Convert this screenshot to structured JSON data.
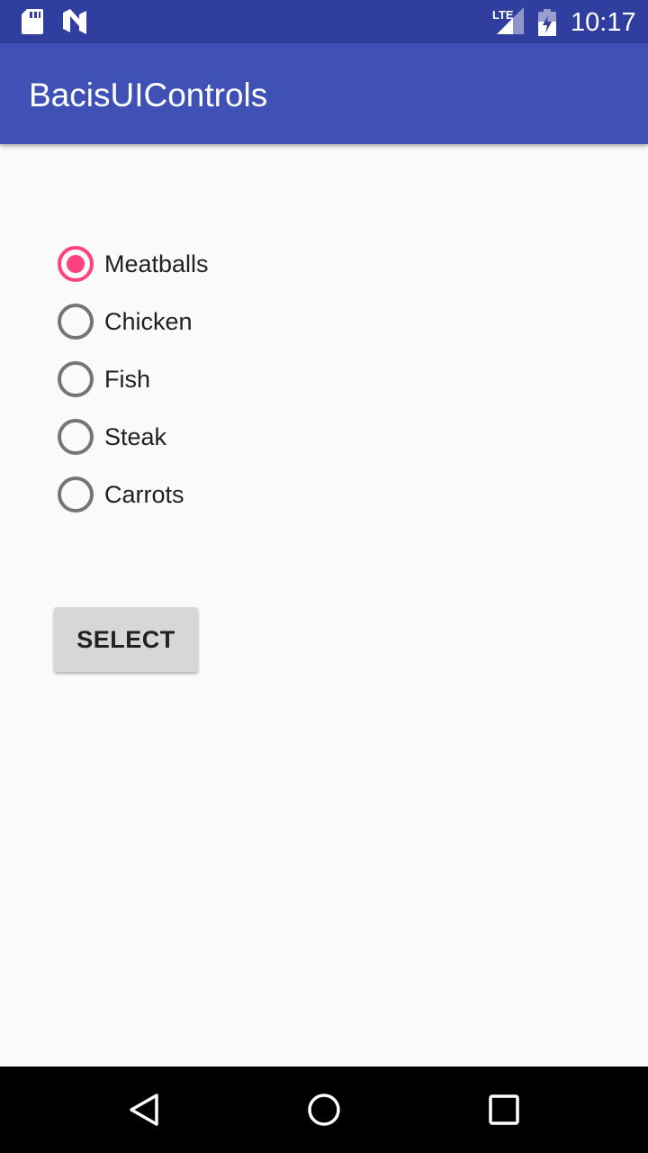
{
  "status_bar": {
    "network": "LTE",
    "time": "10:17",
    "icons": [
      "sd-card-icon",
      "n-notification-icon",
      "lte-signal-icon",
      "battery-charging-icon"
    ]
  },
  "app_bar": {
    "title": "BacisUIControls"
  },
  "radio_group": {
    "selected": "Meatballs",
    "options": [
      {
        "label": "Meatballs",
        "checked": true
      },
      {
        "label": "Chicken",
        "checked": false
      },
      {
        "label": "Fish",
        "checked": false
      },
      {
        "label": "Steak",
        "checked": false
      },
      {
        "label": "Carrots",
        "checked": false
      }
    ]
  },
  "button": {
    "label": "SELECT"
  },
  "navigation": {
    "icons": [
      "back-icon",
      "home-icon",
      "recents-icon"
    ]
  },
  "colors": {
    "status_bar": "#303f9f",
    "app_bar": "#3f51b5",
    "accent": "#ff4081",
    "radio_unchecked": "#757575",
    "background": "#fafafa",
    "button_bg": "#d6d7d7",
    "nav_bar": "#000000"
  }
}
